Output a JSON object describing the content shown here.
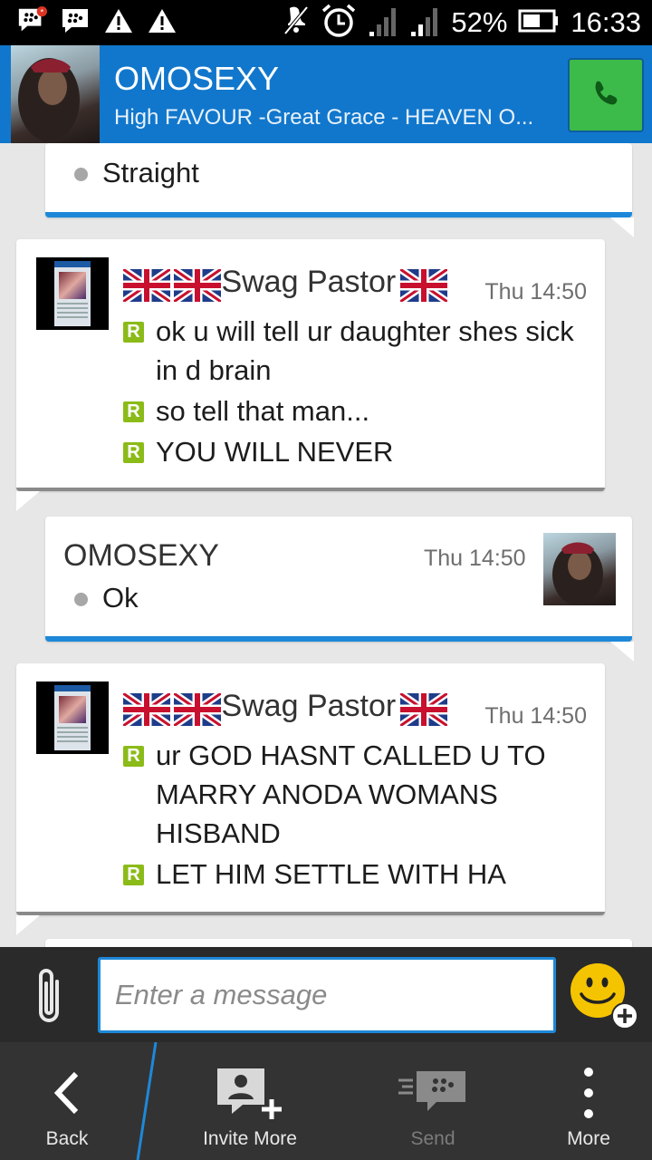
{
  "status_bar": {
    "battery_percent": "52%",
    "time": "16:33",
    "icons": [
      "bbm-notification-icon",
      "bbm-icon",
      "warning-icon",
      "warning-icon",
      "mute-icon",
      "alarm-icon",
      "signal-icon",
      "signal-icon",
      "battery-icon"
    ]
  },
  "header": {
    "contact_name": "OMOSEXY",
    "status_message": "High FAVOUR -Great Grace  - HEAVEN O...",
    "call_icon": "phone-icon"
  },
  "messages": [
    {
      "direction": "out",
      "lines": [
        {
          "text": "Straight"
        }
      ]
    },
    {
      "direction": "in",
      "sender": "Swag Pastor",
      "time": "Thu 14:50",
      "lines": [
        {
          "text": "ok u will tell ur daughter shes sick in d brain",
          "line1": "ok u will tell ur daughter shes sick",
          "line2": "in d brain"
        },
        {
          "text": "so tell that man..."
        },
        {
          "text": "YOU WILL NEVER"
        }
      ]
    },
    {
      "direction": "out",
      "sender": "OMOSEXY",
      "time": "Thu 14:50",
      "lines": [
        {
          "text": "Ok"
        }
      ]
    },
    {
      "direction": "in",
      "sender": "Swag Pastor",
      "time": "Thu 14:50",
      "lines": [
        {
          "text": "ur GOD HASNT CALLED U TO MARRY ANODA WOMANS HISBAND",
          "line1": "ur GOD HASNT CALLED U TO",
          "line2": "MARRY ANODA WOMANS",
          "line3": "HISBAND"
        },
        {
          "text": "LET HIM SETTLE WITH HA"
        }
      ]
    }
  ],
  "composer": {
    "placeholder": "Enter a message",
    "attach_icon": "paperclip-icon",
    "emoji_icon": "emoji-add-icon"
  },
  "nav": {
    "back": "Back",
    "invite_more": "Invite More",
    "send": "Send",
    "more": "More"
  },
  "colors": {
    "header_blue": "#1177cc",
    "accent_blue": "#1e88d8",
    "call_green": "#3dbb4a",
    "read_badge_green": "#8bbb18"
  }
}
